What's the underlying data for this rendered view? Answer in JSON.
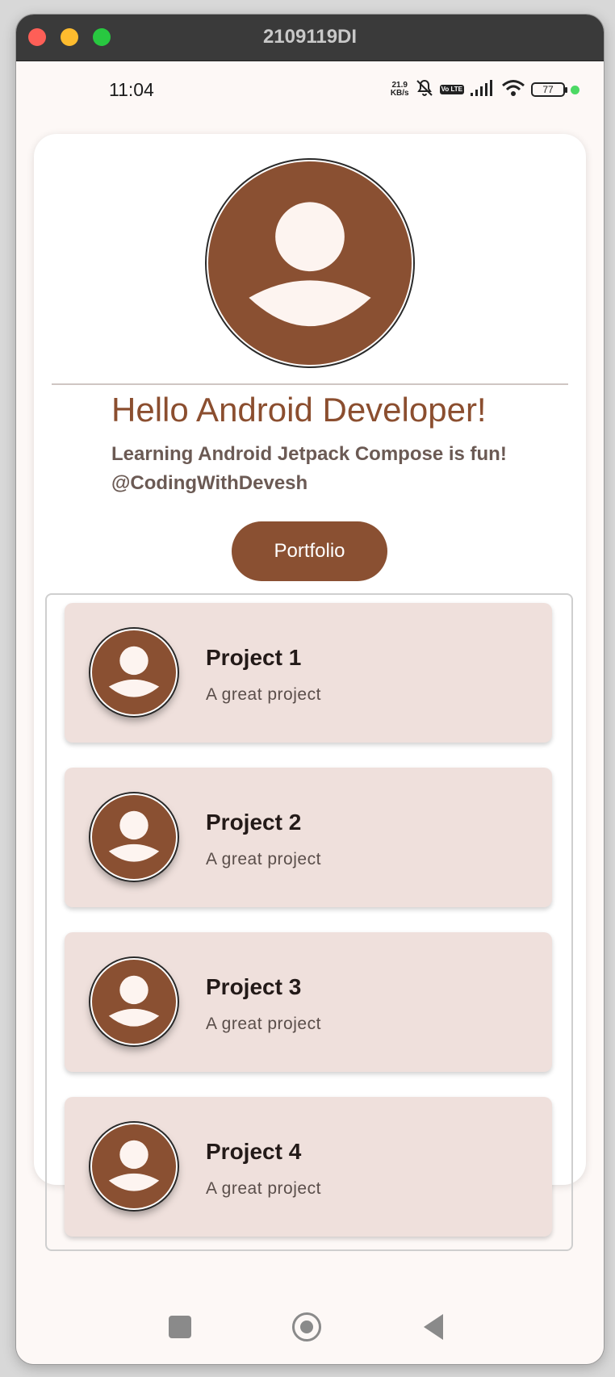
{
  "window": {
    "title": "2109119DI"
  },
  "status_bar": {
    "time": "11:04",
    "net_speed_value": "21.9",
    "net_speed_unit": "KB/s",
    "volte": "Vo LTE",
    "battery": "77"
  },
  "profile": {
    "greeting": "Hello Android Developer!",
    "subtitle_line1": "Learning Android Jetpack Compose is fun!",
    "subtitle_line2": "@CodingWithDevesh",
    "portfolio_label": "Portfolio"
  },
  "projects": [
    {
      "title": "Project 1",
      "description": "A great project"
    },
    {
      "title": "Project 2",
      "description": "A great project"
    },
    {
      "title": "Project 3",
      "description": "A great project"
    },
    {
      "title": "Project 4",
      "description": "A great project"
    }
  ],
  "colors": {
    "brand": "#8a5032",
    "greeting_text": "#8b4e2f",
    "card_background": "#efe0dc",
    "avatar_fill": "#fdf4f0"
  },
  "icons": {
    "nav": [
      "recents-square-icon",
      "home-circle-icon",
      "back-triangle-icon"
    ]
  }
}
